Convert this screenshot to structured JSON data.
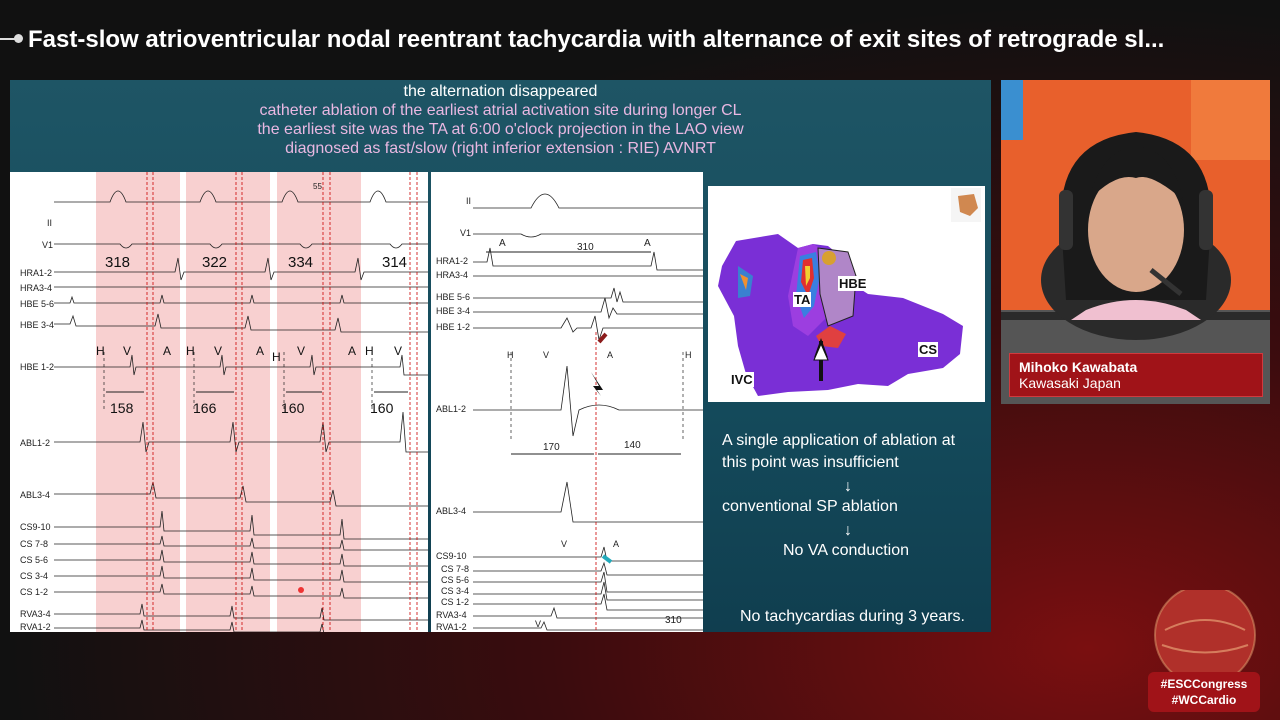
{
  "header": {
    "title": "Fast-slow atrioventricular nodal reentrant tachycardia with alternance of exit sites of retrograde sl..."
  },
  "slide": {
    "heading": "the alternation disappeared",
    "subheading_lines": [
      "catheter ablation of the earliest atrial activation site during longer CL",
      "the earliest site was the TA at 6:00 o'clock projection in the LAO view",
      "diagnosed as fast/slow (right inferior extension : RIE) AVNRT"
    ],
    "tracing1": {
      "leads": [
        "II",
        "V1",
        "HRA1-2",
        "HRA3-4",
        "HBE 5-6",
        "HBE 3-4",
        "HBE 1-2",
        "ABL1-2",
        "ABL3-4",
        "CS9-10",
        "CS 7-8",
        "CS 5-6",
        "CS 3-4",
        "CS 1-2",
        "RVA3-4",
        "RVA1-2"
      ],
      "cycle_lengths": [
        "318",
        "322",
        "334",
        "314"
      ],
      "hv_intervals": [
        "158",
        "166",
        "160",
        "160"
      ],
      "markers": [
        "H",
        "V",
        "A",
        "H",
        "V",
        "A",
        "H",
        "V",
        "A",
        "H",
        "V"
      ],
      "top_mark": "55"
    },
    "tracing2": {
      "leads": [
        "II",
        "V1",
        "HRA1-2",
        "HRA3-4",
        "HBE 5-6",
        "HBE 3-4",
        "HBE 1-2",
        "ABL1-2",
        "ABL3-4",
        "CS9-10",
        "CS 7-8",
        "CS 5-6",
        "CS 3-4",
        "CS 1-2",
        "RVA3-4",
        "RVA1-2"
      ],
      "cycle_length": "310",
      "cycle_length_bottom": "310",
      "interval_left": "170",
      "interval_right": "140",
      "markers": {
        "a1": "A",
        "a2": "A",
        "h1": "H",
        "v1": "V",
        "a3": "A",
        "h2": "H",
        "v2": "V",
        "a4": "A",
        "v3": "V"
      }
    },
    "map_labels": {
      "ta": "TA",
      "hbe": "HBE",
      "cs": "CS",
      "ivc": "IVC"
    },
    "notes": {
      "line1": "A single application of ablation at",
      "line2": "this point was insufficient",
      "arrow1": "↓",
      "line3": "conventional SP ablation",
      "arrow2": "↓",
      "line4": "No VA conduction",
      "footer": "No tachycardias during 3 years."
    }
  },
  "speaker": {
    "name": "Mihoko Kawabata",
    "affiliation": "Kawasaki Japan"
  },
  "hashtags": [
    "#ESCCongress",
    "#WCCardio"
  ],
  "colors": {
    "brand_red": "#a01318",
    "slide_bg": "#1e5565",
    "subheading": "#e9b8e2"
  }
}
